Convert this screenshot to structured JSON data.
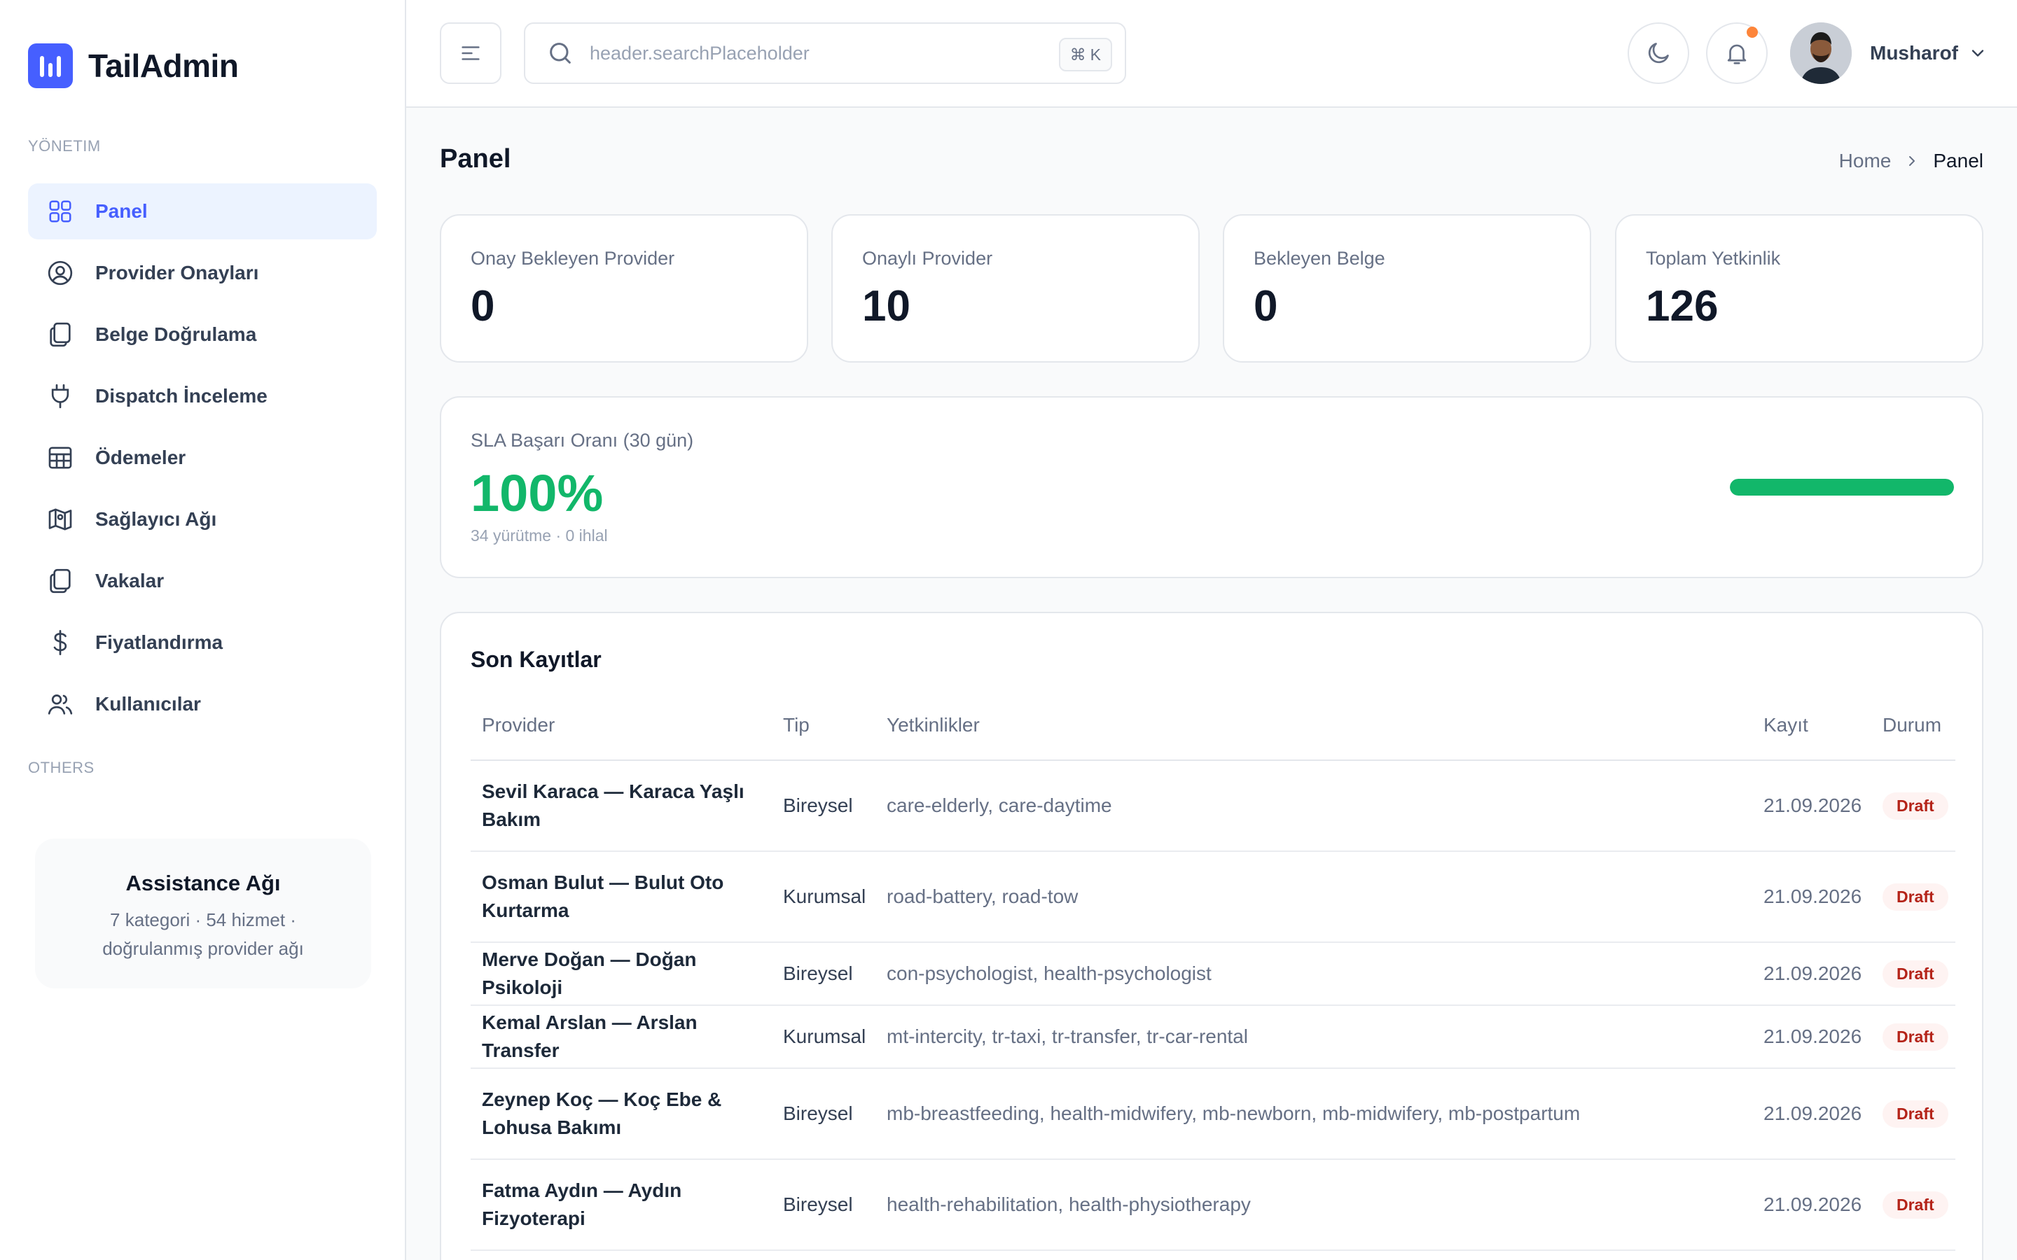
{
  "brand": {
    "name": "TailAdmin",
    "color": "#465fff"
  },
  "sidebar": {
    "section_main": "YÖNETIM",
    "section_others": "OTHERS",
    "items": [
      {
        "label": "Panel",
        "icon": "grid-icon",
        "active": true
      },
      {
        "label": "Provider Onayları",
        "icon": "user-circle-icon"
      },
      {
        "label": "Belge Doğrulama",
        "icon": "documents-icon"
      },
      {
        "label": "Dispatch İnceleme",
        "icon": "plug-icon"
      },
      {
        "label": "Ödemeler",
        "icon": "table-icon"
      },
      {
        "label": "Sağlayıcı Ağı",
        "icon": "map-icon"
      },
      {
        "label": "Vakalar",
        "icon": "documents-icon"
      },
      {
        "label": "Fiyatlandırma",
        "icon": "dollar-icon"
      },
      {
        "label": "Kullanıcılar",
        "icon": "users-icon"
      }
    ],
    "promo": {
      "title": "Assistance Ağı",
      "text": "7 kategori · 54 hizmet · doğrulanmış provider ağı"
    }
  },
  "header": {
    "search_placeholder": "header.searchPlaceholder",
    "shortcut_symbol": "⌘",
    "shortcut_key": "K",
    "user_name": "Musharof",
    "notification_dot_color": "#fd853a"
  },
  "page": {
    "title": "Panel",
    "breadcrumb_home": "Home",
    "breadcrumb_current": "Panel"
  },
  "stats": [
    {
      "label": "Onay Bekleyen Provider",
      "value": "0"
    },
    {
      "label": "Onaylı Provider",
      "value": "10"
    },
    {
      "label": "Bekleyen Belge",
      "value": "0"
    },
    {
      "label": "Toplam Yetkinlik",
      "value": "126"
    }
  ],
  "sla": {
    "label": "SLA Başarı Oranı (30 gün)",
    "value": "100%",
    "sub": "34 yürütme · 0 ihlal",
    "progress": 1.0,
    "color": "#12b76a"
  },
  "recent": {
    "title": "Son Kayıtlar",
    "columns": [
      "Provider",
      "Tip",
      "Yetkinlikler",
      "Kayıt",
      "Durum"
    ],
    "rows": [
      {
        "provider": "Sevil Karaca — Karaca Yaşlı Bakım",
        "tip": "Bireysel",
        "skills": "care-elderly, care-daytime",
        "date": "21.09.2026",
        "status": "Draft"
      },
      {
        "provider": "Osman Bulut — Bulut Oto Kurtarma",
        "tip": "Kurumsal",
        "skills": "road-battery, road-tow",
        "date": "21.09.2026",
        "status": "Draft"
      },
      {
        "provider": "Merve Doğan — Doğan Psikoloji",
        "tip": "Bireysel",
        "skills": "con-psychologist, health-psychologist",
        "date": "21.09.2026",
        "status": "Draft"
      },
      {
        "provider": "Kemal Arslan — Arslan Transfer",
        "tip": "Kurumsal",
        "skills": "mt-intercity, tr-taxi, tr-transfer, tr-car-rental",
        "date": "21.09.2026",
        "status": "Draft"
      },
      {
        "provider": "Zeynep Koç — Koç Ebe & Lohusa Bakımı",
        "tip": "Bireysel",
        "skills": "mb-breastfeeding, health-midwifery, mb-newborn, mb-midwifery, mb-postpartum",
        "date": "21.09.2026",
        "status": "Draft"
      },
      {
        "provider": "Fatma Aydın — Aydın Fizyoterapi",
        "tip": "Bireysel",
        "skills": "health-rehabilitation, health-physiotherapy",
        "date": "21.09.2026",
        "status": "Draft"
      }
    ]
  }
}
